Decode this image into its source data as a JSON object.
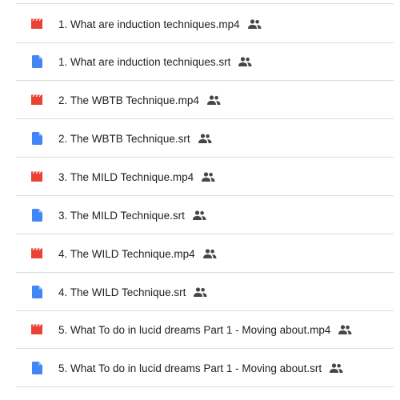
{
  "files": [
    {
      "name": "1. What are induction techniques.mp4",
      "type": "video",
      "icon": "video-file-icon",
      "shared": true
    },
    {
      "name": "1. What are induction techniques.srt",
      "type": "document",
      "icon": "document-file-icon",
      "shared": true
    },
    {
      "name": "2. The WBTB Technique.mp4",
      "type": "video",
      "icon": "video-file-icon",
      "shared": true
    },
    {
      "name": "2. The WBTB Technique.srt",
      "type": "document",
      "icon": "document-file-icon",
      "shared": true
    },
    {
      "name": "3. The MILD Technique.mp4",
      "type": "video",
      "icon": "video-file-icon",
      "shared": true
    },
    {
      "name": "3. The MILD Technique.srt",
      "type": "document",
      "icon": "document-file-icon",
      "shared": true
    },
    {
      "name": "4. The WILD Technique.mp4",
      "type": "video",
      "icon": "video-file-icon",
      "shared": true
    },
    {
      "name": "4. The WILD Technique.srt",
      "type": "document",
      "icon": "document-file-icon",
      "shared": true
    },
    {
      "name": "5. What To do in lucid dreams Part 1 - Moving about.mp4",
      "type": "video",
      "icon": "video-file-icon",
      "shared": true
    },
    {
      "name": "5. What To do in lucid dreams Part 1 - Moving about.srt",
      "type": "document",
      "icon": "document-file-icon",
      "shared": true
    }
  ],
  "colors": {
    "video": "#ea4335",
    "document": "#4285f4",
    "shared": "#444746",
    "divider": "#dadce0"
  }
}
